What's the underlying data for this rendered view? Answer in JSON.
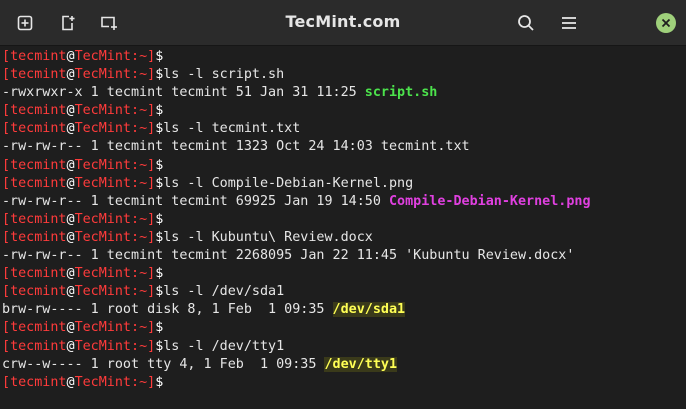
{
  "window": {
    "title": "TecMint.com"
  },
  "colors": {
    "prompt_red": "#ff3b3b",
    "path_blue": "#3ea6ff",
    "exec_green": "#4ce34c",
    "image_magenta": "#e040e0",
    "device_yellow": "#ffff55",
    "close_green": "#9fd07b"
  },
  "prompt": {
    "user": "tecmint",
    "host": "TecMint",
    "path": "~",
    "symbol": "$"
  },
  "terminal_lines": [
    {
      "type": "prompt",
      "cmd": ""
    },
    {
      "type": "prompt",
      "cmd": "ls -l script.sh"
    },
    {
      "type": "output",
      "text": "-rwxrwxr-x 1 tecmint tecmint 51 Jan 31 11:25 ",
      "name": "script.sh",
      "style": "exec"
    },
    {
      "type": "prompt",
      "cmd": ""
    },
    {
      "type": "prompt",
      "cmd": "ls -l tecmint.txt"
    },
    {
      "type": "output",
      "text": "-rw-rw-r-- 1 tecmint tecmint 1323 Oct 24 14:03 ",
      "name": "tecmint.txt",
      "style": "plain"
    },
    {
      "type": "prompt",
      "cmd": ""
    },
    {
      "type": "prompt",
      "cmd": "ls -l Compile-Debian-Kernel.png"
    },
    {
      "type": "output",
      "text": "-rw-rw-r-- 1 tecmint tecmint 69925 Jan 19 14:50 ",
      "name": "Compile-Debian-Kernel.png",
      "style": "img"
    },
    {
      "type": "prompt",
      "cmd": ""
    },
    {
      "type": "prompt",
      "cmd": "ls -l Kubuntu\\ Review.docx"
    },
    {
      "type": "output",
      "text": "-rw-rw-r-- 1 tecmint tecmint 2268095 Jan 22 11:45 ",
      "name": "'Kubuntu Review.docx'",
      "style": "plain"
    },
    {
      "type": "prompt",
      "cmd": ""
    },
    {
      "type": "prompt",
      "cmd": "ls -l /dev/sda1"
    },
    {
      "type": "output",
      "text": "brw-rw---- 1 root disk 8, 1 Feb  1 09:35 ",
      "name": "/dev/sda1",
      "style": "dev"
    },
    {
      "type": "prompt",
      "cmd": ""
    },
    {
      "type": "prompt",
      "cmd": "ls -l /dev/tty1"
    },
    {
      "type": "output",
      "text": "crw--w---- 1 root tty 4, 1 Feb  1 09:35 ",
      "name": "/dev/tty1",
      "style": "dev"
    },
    {
      "type": "prompt",
      "cmd": ""
    }
  ]
}
